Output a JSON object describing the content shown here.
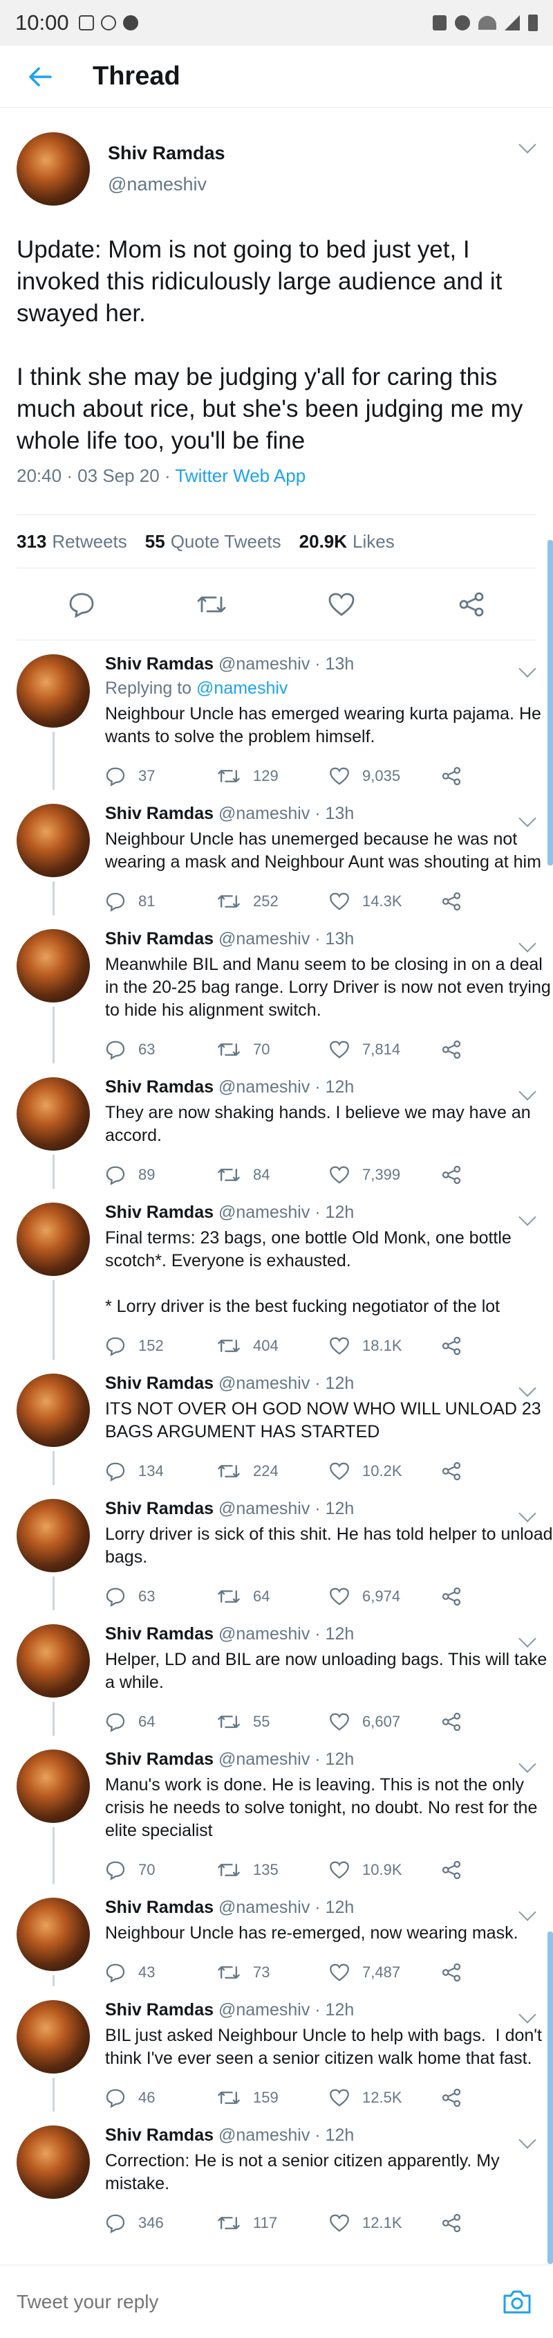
{
  "status_bar": {
    "time": "10:00"
  },
  "header": {
    "title": "Thread"
  },
  "main_tweet": {
    "name": "Shiv Ramdas",
    "handle": "@nameshiv",
    "text": "Update: Mom is not going to bed just yet, I invoked this ridiculously large audience and it swayed her.\n\nI think she may be judging y'all for caring this much about rice, but she's been judging me my whole life too, you'll be fine",
    "timestamp": "20:40 · 03 Sep 20 · ",
    "app": "Twitter Web App",
    "retweets_count": "313",
    "retweets_label": "Retweets",
    "quotes_count": "55",
    "quotes_label": "Quote Tweets",
    "likes_count": "20.9K",
    "likes_label": "Likes"
  },
  "replies": [
    {
      "name": "Shiv Ramdas",
      "meta": "@nameshiv · 13h",
      "replying_prefix": "Replying to ",
      "replying_to": "@nameshiv",
      "text": "Neighbour Uncle has emerged wearing kurta pajama. He wants to solve the problem himself.",
      "replies": "37",
      "retweets": "129",
      "likes": "9,035"
    },
    {
      "name": "Shiv Ramdas",
      "meta": "@nameshiv · 13h",
      "text": "Neighbour Uncle has unemerged because he was not wearing a mask and Neighbour Aunt was shouting at him",
      "replies": "81",
      "retweets": "252",
      "likes": "14.3K"
    },
    {
      "name": "Shiv Ramdas",
      "meta": "@nameshiv · 13h",
      "text": "Meanwhile BIL and Manu seem to be closing in on a deal in the 20-25 bag range. Lorry Driver is now not even trying to hide his alignment switch.",
      "replies": "63",
      "retweets": "70",
      "likes": "7,814"
    },
    {
      "name": "Shiv Ramdas",
      "meta": "@nameshiv · 12h",
      "text": "They are now shaking hands. I believe we may have an accord.",
      "replies": "89",
      "retweets": "84",
      "likes": "7,399"
    },
    {
      "name": "Shiv Ramdas",
      "meta": "@nameshiv · 12h",
      "text": "Final terms: 23 bags, one bottle Old Monk, one bottle scotch*. Everyone is exhausted.\n\n* Lorry driver is the best fucking negotiator of the lot",
      "replies": "152",
      "retweets": "404",
      "likes": "18.1K"
    },
    {
      "name": "Shiv Ramdas",
      "meta": "@nameshiv · 12h",
      "text": "ITS NOT OVER OH GOD NOW WHO WILL UNLOAD 23 BAGS ARGUMENT HAS STARTED",
      "replies": "134",
      "retweets": "224",
      "likes": "10.2K"
    },
    {
      "name": "Shiv Ramdas",
      "meta": "@nameshiv · 12h",
      "text": "Lorry driver is sick of this shit. He has told helper to unload bags.",
      "replies": "63",
      "retweets": "64",
      "likes": "6,974"
    },
    {
      "name": "Shiv Ramdas",
      "meta": "@nameshiv · 12h",
      "text": "Helper, LD and BIL are now unloading bags. This will take a while.",
      "replies": "64",
      "retweets": "55",
      "likes": "6,607"
    },
    {
      "name": "Shiv Ramdas",
      "meta": "@nameshiv · 12h",
      "text": "Manu's work is done. He is leaving. This is not the only crisis he needs to solve tonight, no doubt. No rest for the elite specialist",
      "replies": "70",
      "retweets": "135",
      "likes": "10.9K"
    },
    {
      "name": "Shiv Ramdas",
      "meta": "@nameshiv · 12h",
      "text": "Neighbour Uncle has re-emerged, now wearing mask.",
      "replies": "43",
      "retweets": "73",
      "likes": "7,487"
    },
    {
      "name": "Shiv Ramdas",
      "meta": "@nameshiv · 12h",
      "text": "BIL just asked Neighbour Uncle to help with bags.  I don't think I've ever seen a senior citizen walk home that fast.",
      "replies": "46",
      "retweets": "159",
      "likes": "12.5K"
    },
    {
      "name": "Shiv Ramdas",
      "meta": "@nameshiv · 12h",
      "text": "Correction: He is not a senior citizen apparently. My mistake.",
      "replies": "346",
      "retweets": "117",
      "likes": "12.1K"
    }
  ],
  "compose": {
    "placeholder": "Tweet your reply"
  },
  "colors": {
    "accent": "#1da1f2",
    "secondary_text": "#657786",
    "divider": "#e6ecf0"
  }
}
